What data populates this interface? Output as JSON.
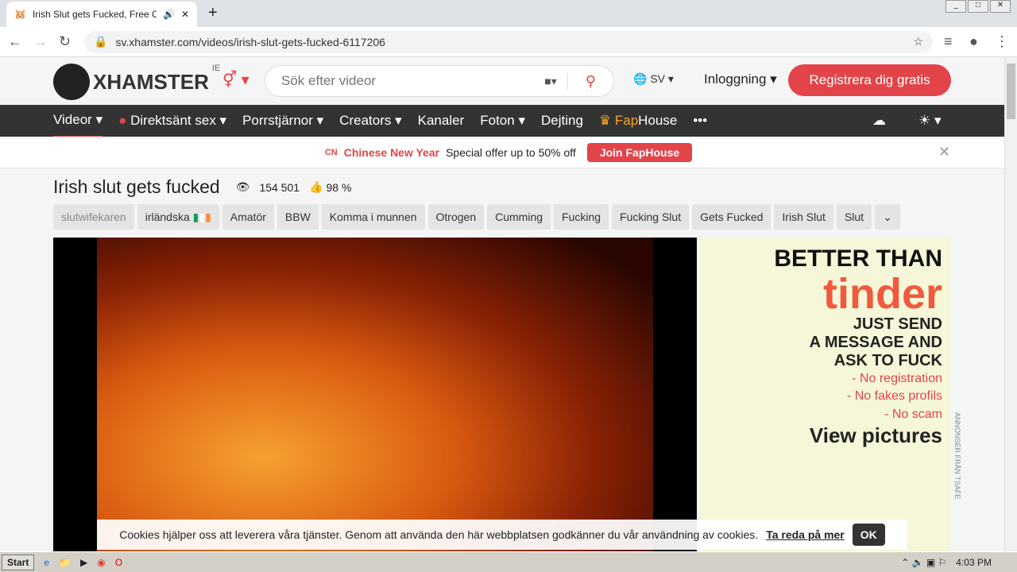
{
  "browser": {
    "tab_title": "Irish Slut gets Fucked, Free Cum",
    "url": "sv.xhamster.com/videos/irish-slut-gets-fucked-6117206"
  },
  "header": {
    "logo": "XHAMSTER",
    "region": "IE",
    "search_placeholder": "Sök efter videor",
    "lang": "SV",
    "login": "Inloggning",
    "register": "Registrera dig gratis"
  },
  "nav": [
    "Videor",
    "Direktsänt sex",
    "Porrstjärnor",
    "Creators",
    "Kanaler",
    "Foton",
    "Dejting"
  ],
  "nav_fap": {
    "a": "Fap",
    "b": "House"
  },
  "promo": {
    "cn": "CN",
    "bold": "Chinese New Year",
    "text": "Special offer up to 50% off",
    "button": "Join FapHouse"
  },
  "video": {
    "title": "Irish slut gets fucked",
    "views": "154 501",
    "likes": "98 %"
  },
  "tags": [
    "slutwifekaren",
    "irländska",
    "Amatör",
    "BBW",
    "Komma i munnen",
    "Otrogen",
    "Cumming",
    "Fucking",
    "Fucking Slut",
    "Gets Fucked",
    "Irish Slut",
    "Slut"
  ],
  "ad": {
    "l1": "BETTER THAN",
    "l2": "tinder",
    "l3": "JUST SEND",
    "l4": "A MESSAGE AND",
    "l5": "ASK TO FUCK",
    "b1": "- No registration",
    "b2": "- No fakes profils",
    "b3": "- No scam",
    "cta": "View pictures",
    "label": "ANNONSER FRÅN TSAFE"
  },
  "cookie": {
    "text": "Cookies hjälper oss att leverera våra tjänster. Genom att använda den här webbplatsen godkänner du vår användning av cookies.",
    "link": "Ta reda på mer",
    "ok": "OK"
  },
  "taskbar": {
    "start": "Start",
    "time": "4:03 PM"
  }
}
